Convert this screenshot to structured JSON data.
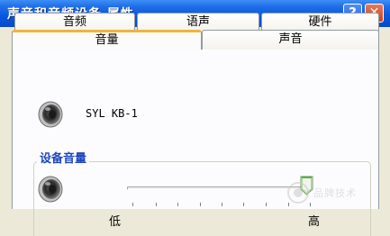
{
  "window": {
    "title": "声音和音频设备 属性",
    "help_label": "?",
    "close_label": "✕"
  },
  "tabs_row1": [
    {
      "label": "音频",
      "name": "tab-audio"
    },
    {
      "label": "语声",
      "name": "tab-voice"
    },
    {
      "label": "硬件",
      "name": "tab-hardware"
    }
  ],
  "tabs_row2": [
    {
      "label": "音量",
      "name": "tab-volume",
      "selected": true
    },
    {
      "label": "声音",
      "name": "tab-sounds",
      "selected": false
    }
  ],
  "device": {
    "icon": "speaker-icon",
    "name": "SYL KB-1"
  },
  "device_volume": {
    "group_label": "设备音量",
    "icon": "speaker-icon",
    "slider_low_label": "低",
    "slider_high_label": "高",
    "level_fraction": 0.98
  },
  "watermark": {
    "text": "品牌技术"
  },
  "colors": {
    "titlebar": "#0a5ae0",
    "selected_tab_accent": "#f0b43c",
    "group_label": "#1c46be",
    "panel": "#ece9d8"
  }
}
